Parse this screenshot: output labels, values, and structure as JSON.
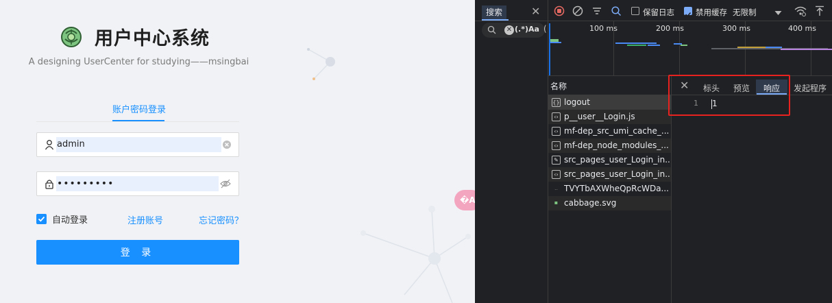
{
  "login": {
    "title": "用户中心系统",
    "description": "A designing UserCenter for studying——msingbai",
    "tab_label": "账户密码登录",
    "username_value": "admin",
    "password_value": "•••••••••",
    "remember_label": "自动登录",
    "register_link": "注册账号",
    "forgot_link": "忘记密码？",
    "login_button": "登 录",
    "translate_icon_text": "�A",
    "colors": {
      "primary": "#1890ff",
      "background": "#f0f2f5"
    }
  },
  "devtools": {
    "search_tab": "搜索",
    "search_options": "(.*)Aa",
    "search_paren": "(",
    "toolbar": {
      "preserve_log": "保留日志",
      "disable_cache": "禁用缓存",
      "throttle": "无限制",
      "disable_cache_checked": true,
      "preserve_log_checked": false
    },
    "timeline_ticks": [
      "100 ms",
      "200 ms",
      "300 ms",
      "400 ms"
    ],
    "name_header": "名称",
    "requests": [
      {
        "name": "logout",
        "icon": "xhr-icon",
        "selected": true
      },
      {
        "name": "p__user__Login.js",
        "icon": "script-icon"
      },
      {
        "name": "mf-dep_src_umi_cache_...",
        "icon": "script-icon"
      },
      {
        "name": "mf-dep_node_modules_...",
        "icon": "script-icon"
      },
      {
        "name": "src_pages_user_Login_in...",
        "icon": "stylesheet-icon"
      },
      {
        "name": "src_pages_user_Login_in...",
        "icon": "script-icon"
      },
      {
        "name": "TVYTbAXWheQpRcWDa...",
        "icon": "font-icon"
      },
      {
        "name": "cabbage.svg",
        "icon": "image-icon"
      }
    ],
    "detail_tabs": [
      "标头",
      "预览",
      "响应",
      "发起程序"
    ],
    "active_detail_tab": "响应",
    "response": {
      "line_number": "1",
      "content": "1"
    },
    "colors": {
      "highlight": "#e8231f",
      "accent": "#7cacf8"
    }
  }
}
